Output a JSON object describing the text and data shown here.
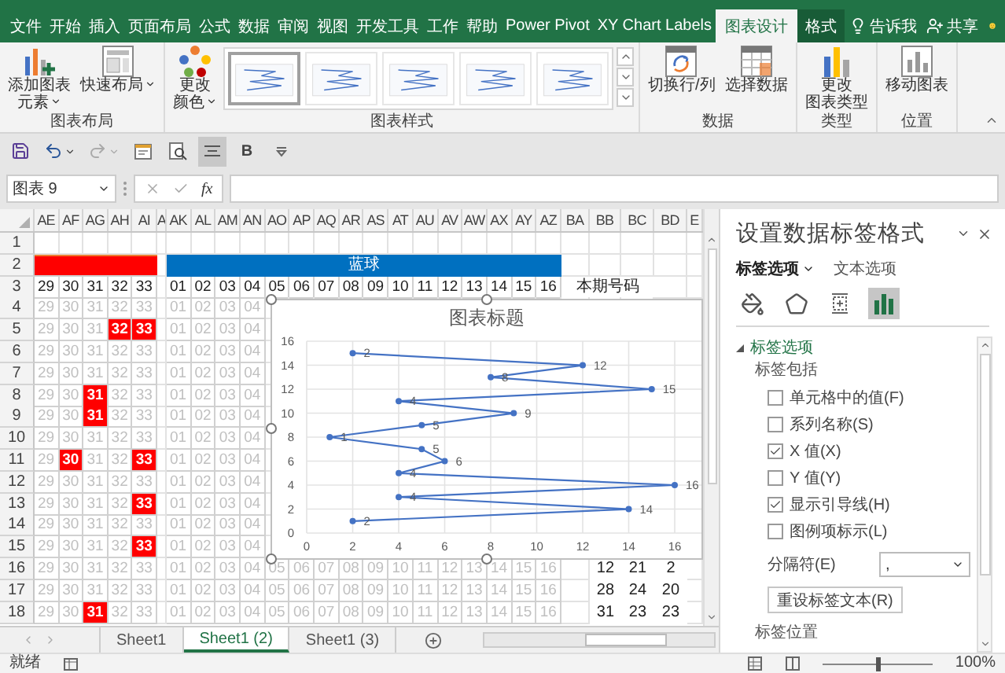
{
  "ribbon": {
    "tabs": [
      {
        "label": "文件",
        "selected": false,
        "contextual": false
      },
      {
        "label": "开始",
        "selected": false,
        "contextual": false
      },
      {
        "label": "插入",
        "selected": false,
        "contextual": false
      },
      {
        "label": "页面布局",
        "selected": false,
        "contextual": false
      },
      {
        "label": "公式",
        "selected": false,
        "contextual": false
      },
      {
        "label": "数据",
        "selected": false,
        "contextual": false
      },
      {
        "label": "审阅",
        "selected": false,
        "contextual": false
      },
      {
        "label": "视图",
        "selected": false,
        "contextual": false
      },
      {
        "label": "开发工具",
        "selected": false,
        "contextual": false
      },
      {
        "label": "工作",
        "selected": false,
        "contextual": false
      },
      {
        "label": "帮助",
        "selected": false,
        "contextual": false
      },
      {
        "label": "Power Pivot",
        "selected": false,
        "contextual": false
      },
      {
        "label": "XY Chart Labels",
        "selected": false,
        "contextual": false
      },
      {
        "label": "图表设计",
        "selected": true,
        "contextual": true
      },
      {
        "label": "格式",
        "selected": false,
        "contextual": true
      }
    ],
    "tell_me": "告诉我",
    "share": "共享",
    "groups": [
      {
        "label": "图表布局",
        "buttons": [
          {
            "lines": [
              "添加图表",
              "元素"
            ],
            "dropdown": true
          },
          {
            "lines": [
              "快速布局"
            ],
            "dropdown": true
          }
        ]
      },
      {
        "label": "图表样式",
        "buttons": [
          {
            "lines": [
              "更改",
              "颜色"
            ],
            "dropdown": true
          }
        ],
        "styles": [
          {
            "selected": true
          },
          {
            "selected": false
          },
          {
            "selected": false
          },
          {
            "selected": false
          },
          {
            "selected": false
          }
        ]
      },
      {
        "label": "数据",
        "buttons": [
          {
            "lines": [
              "切换行/列"
            ],
            "dropdown": false
          },
          {
            "lines": [
              "选择数据"
            ],
            "dropdown": false
          }
        ]
      },
      {
        "label": "类型",
        "buttons": [
          {
            "lines": [
              "更改",
              "图表类型"
            ],
            "dropdown": false
          }
        ]
      },
      {
        "label": "位置",
        "buttons": [
          {
            "lines": [
              "移动图表"
            ],
            "dropdown": false
          }
        ]
      }
    ]
  },
  "quick_access": [
    {
      "kind": "save",
      "selected": false
    },
    {
      "kind": "undo",
      "selected": false
    },
    {
      "kind": "redo",
      "selected": false
    },
    {
      "kind": "form",
      "selected": false
    },
    {
      "kind": "preview",
      "selected": false
    },
    {
      "kind": "align",
      "selected": true
    },
    {
      "kind": "bold",
      "selected": false,
      "label": "B"
    },
    {
      "kind": "customize",
      "selected": false
    }
  ],
  "formula_bar": {
    "name_box": "图表 9",
    "function_label": "fx"
  },
  "sheet": {
    "columns": [
      "AE",
      "AF",
      "AG",
      "AH",
      "AI",
      "A",
      "AK",
      "AL",
      "AM",
      "AN",
      "AO",
      "AP",
      "AQ",
      "AR",
      "AS",
      "AT",
      "AU",
      "AV",
      "AW",
      "AX",
      "AY",
      "AZ",
      "BA",
      "BB",
      "BC",
      "BD",
      "E"
    ],
    "rows": [
      {
        "header": "1",
        "kind": "blank"
      },
      {
        "header": "2",
        "kind": "band",
        "band_label": "蓝球"
      },
      {
        "header": "3",
        "kind": "heading",
        "red": [
          {
            "text": "29",
            "highlighted": false
          },
          {
            "text": "30",
            "highlighted": false
          },
          {
            "text": "31",
            "highlighted": false
          },
          {
            "text": "32",
            "highlighted": false
          },
          {
            "text": "33",
            "highlighted": false
          }
        ],
        "blue": [
          "01",
          "02",
          "03",
          "04",
          "05",
          "06",
          "07",
          "08",
          "09",
          "10",
          "11",
          "12",
          "13",
          "14",
          "15",
          "16"
        ],
        "note": "本期号码"
      },
      {
        "header": "4",
        "kind": "data",
        "red": [
          {
            "text": "29",
            "highlighted": false
          },
          {
            "text": "30",
            "highlighted": false
          },
          {
            "text": "31",
            "highlighted": false
          },
          {
            "text": "32",
            "highlighted": false
          },
          {
            "text": "33",
            "highlighted": false
          }
        ],
        "blue": [
          "01",
          "02",
          "03",
          "04"
        ]
      },
      {
        "header": "5",
        "kind": "data",
        "red": [
          {
            "text": "29",
            "highlighted": false
          },
          {
            "text": "30",
            "highlighted": false
          },
          {
            "text": "31",
            "highlighted": false
          },
          {
            "text": "32",
            "highlighted": true
          },
          {
            "text": "33",
            "highlighted": true
          }
        ],
        "blue": [
          "01",
          "02",
          "03",
          "04"
        ]
      },
      {
        "header": "6",
        "kind": "data",
        "red": [
          {
            "text": "29",
            "highlighted": false
          },
          {
            "text": "30",
            "highlighted": false
          },
          {
            "text": "31",
            "highlighted": false
          },
          {
            "text": "32",
            "highlighted": false
          },
          {
            "text": "33",
            "highlighted": false
          }
        ],
        "blue": [
          "01",
          "02",
          "03",
          "04"
        ]
      },
      {
        "header": "7",
        "kind": "data",
        "red": [
          {
            "text": "29",
            "highlighted": false
          },
          {
            "text": "30",
            "highlighted": false
          },
          {
            "text": "31",
            "highlighted": false
          },
          {
            "text": "32",
            "highlighted": false
          },
          {
            "text": "33",
            "highlighted": false
          }
        ],
        "blue": [
          "01",
          "02",
          "03",
          "04"
        ]
      },
      {
        "header": "8",
        "kind": "data",
        "red": [
          {
            "text": "29",
            "highlighted": false
          },
          {
            "text": "30",
            "highlighted": false
          },
          {
            "text": "31",
            "highlighted": true
          },
          {
            "text": "32",
            "highlighted": false
          },
          {
            "text": "33",
            "highlighted": false
          }
        ],
        "blue": [
          "01",
          "02",
          "03",
          "04"
        ]
      },
      {
        "header": "9",
        "kind": "data",
        "red": [
          {
            "text": "29",
            "highlighted": false
          },
          {
            "text": "30",
            "highlighted": false
          },
          {
            "text": "31",
            "highlighted": true
          },
          {
            "text": "32",
            "highlighted": false
          },
          {
            "text": "33",
            "highlighted": false
          }
        ],
        "blue": [
          "01",
          "02",
          "03",
          "04"
        ]
      },
      {
        "header": "10",
        "kind": "data",
        "red": [
          {
            "text": "29",
            "highlighted": false
          },
          {
            "text": "30",
            "highlighted": false
          },
          {
            "text": "31",
            "highlighted": false
          },
          {
            "text": "32",
            "highlighted": false
          },
          {
            "text": "33",
            "highlighted": false
          }
        ],
        "blue": [
          "01",
          "02",
          "03",
          "04"
        ]
      },
      {
        "header": "11",
        "kind": "data",
        "red": [
          {
            "text": "29",
            "highlighted": false
          },
          {
            "text": "30",
            "highlighted": true
          },
          {
            "text": "31",
            "highlighted": false
          },
          {
            "text": "32",
            "highlighted": false
          },
          {
            "text": "33",
            "highlighted": true
          }
        ],
        "blue": [
          "01",
          "02",
          "03",
          "04"
        ]
      },
      {
        "header": "12",
        "kind": "data",
        "red": [
          {
            "text": "29",
            "highlighted": false
          },
          {
            "text": "30",
            "highlighted": false
          },
          {
            "text": "31",
            "highlighted": false
          },
          {
            "text": "32",
            "highlighted": false
          },
          {
            "text": "33",
            "highlighted": false
          }
        ],
        "blue": [
          "01",
          "02",
          "03",
          "04"
        ]
      },
      {
        "header": "13",
        "kind": "data",
        "red": [
          {
            "text": "29",
            "highlighted": false
          },
          {
            "text": "30",
            "highlighted": false
          },
          {
            "text": "31",
            "highlighted": false
          },
          {
            "text": "32",
            "highlighted": false
          },
          {
            "text": "33",
            "highlighted": true
          }
        ],
        "blue": [
          "01",
          "02",
          "03",
          "04"
        ]
      },
      {
        "header": "14",
        "kind": "data",
        "red": [
          {
            "text": "29",
            "highlighted": false
          },
          {
            "text": "30",
            "highlighted": false
          },
          {
            "text": "31",
            "highlighted": false
          },
          {
            "text": "32",
            "highlighted": false
          },
          {
            "text": "33",
            "highlighted": false
          }
        ],
        "blue": [
          "01",
          "02",
          "03",
          "04"
        ]
      },
      {
        "header": "15",
        "kind": "data",
        "red": [
          {
            "text": "29",
            "highlighted": false
          },
          {
            "text": "30",
            "highlighted": false
          },
          {
            "text": "31",
            "highlighted": false
          },
          {
            "text": "32",
            "highlighted": false
          },
          {
            "text": "33",
            "highlighted": true
          }
        ],
        "blue": [
          "01",
          "02",
          "03",
          "04"
        ]
      },
      {
        "header": "16",
        "kind": "data",
        "red": [
          {
            "text": "29",
            "highlighted": false
          },
          {
            "text": "30",
            "highlighted": false
          },
          {
            "text": "31",
            "highlighted": false
          },
          {
            "text": "32",
            "highlighted": false
          },
          {
            "text": "33",
            "highlighted": false
          }
        ],
        "blue": [
          "01",
          "02",
          "03",
          "04",
          "05",
          "06",
          "07",
          "08",
          "09",
          "10",
          "11",
          "12",
          "13",
          "14",
          "15",
          "16"
        ],
        "extra": [
          "12",
          "21",
          "2"
        ]
      },
      {
        "header": "17",
        "kind": "data",
        "red": [
          {
            "text": "29",
            "highlighted": false
          },
          {
            "text": "30",
            "highlighted": false
          },
          {
            "text": "31",
            "highlighted": false
          },
          {
            "text": "32",
            "highlighted": false
          },
          {
            "text": "33",
            "highlighted": false
          }
        ],
        "blue": [
          "01",
          "02",
          "03",
          "04",
          "05",
          "06",
          "07",
          "08",
          "09",
          "10",
          "11",
          "12",
          "13",
          "14",
          "15",
          "16"
        ],
        "extra": [
          "28",
          "24",
          "20"
        ]
      },
      {
        "header": "18",
        "kind": "data",
        "red": [
          {
            "text": "29",
            "highlighted": false
          },
          {
            "text": "30",
            "highlighted": false
          },
          {
            "text": "31",
            "highlighted": true
          },
          {
            "text": "32",
            "highlighted": false
          },
          {
            "text": "33",
            "highlighted": false
          }
        ],
        "blue": [
          "01",
          "02",
          "03",
          "04",
          "05",
          "06",
          "07",
          "08",
          "09",
          "10",
          "11",
          "12",
          "13",
          "14",
          "15",
          "16"
        ],
        "extra": [
          "31",
          "23",
          "23"
        ]
      }
    ]
  },
  "chart": {
    "chart_data": {
      "type": "line",
      "title": "图表标题",
      "grid": true,
      "x": [
        2,
        12,
        8,
        15,
        4,
        9,
        5,
        1,
        5,
        6,
        4,
        16,
        4,
        14,
        2
      ],
      "series": [
        {
          "color": "#4472c4",
          "marker": true,
          "values": [
            15,
            14,
            13,
            12,
            11,
            10,
            9,
            8,
            7,
            6,
            5,
            4,
            3,
            2,
            1
          ]
        }
      ],
      "xlim": [
        0,
        16
      ],
      "ylim": [
        0,
        16
      ],
      "xticks": [
        0,
        2,
        4,
        6,
        8,
        10,
        12,
        14,
        16
      ],
      "yticks": [
        0,
        2,
        4,
        6,
        8,
        10,
        12,
        14,
        16
      ],
      "value_labels": [
        "2",
        "12",
        "8",
        "15",
        "4",
        "9",
        "5",
        "1",
        "5",
        "6",
        "4",
        "16",
        "4",
        "14",
        "2"
      ]
    }
  },
  "sheet_tabs": [
    {
      "label": "Sheet1",
      "selected": false
    },
    {
      "label": "Sheet1 (2)",
      "selected": true
    },
    {
      "label": "Sheet1 (3)",
      "selected": false
    }
  ],
  "format_pane": {
    "title": "设置数据标签格式",
    "tabs": [
      {
        "label": "标签选项",
        "selected": true,
        "dropdown": true
      },
      {
        "label": "文本选项",
        "selected": false,
        "dropdown": false
      }
    ],
    "icon_tabs": [
      {
        "selected": false
      },
      {
        "selected": false
      },
      {
        "selected": false
      },
      {
        "selected": true
      }
    ],
    "section": {
      "label": "标签选项",
      "expanded": true
    },
    "group_label": "标签包括",
    "options": [
      {
        "label": "单元格中的值(F)",
        "checked": false
      },
      {
        "label": "系列名称(S)",
        "checked": false
      },
      {
        "label": "X 值(X)",
        "checked": true
      },
      {
        "label": "Y 值(Y)",
        "checked": false
      },
      {
        "label": "显示引导线(H)",
        "checked": true
      },
      {
        "label": "图例项标示(L)",
        "checked": false
      }
    ],
    "separator": {
      "label": "分隔符(E)",
      "value": ","
    },
    "reset_button": "重设标签文本(R)",
    "next_section": "标签位置"
  },
  "status_bar": {
    "status": "就绪",
    "zoom": "100%",
    "zoom_level": {
      "level": 0.5
    }
  }
}
